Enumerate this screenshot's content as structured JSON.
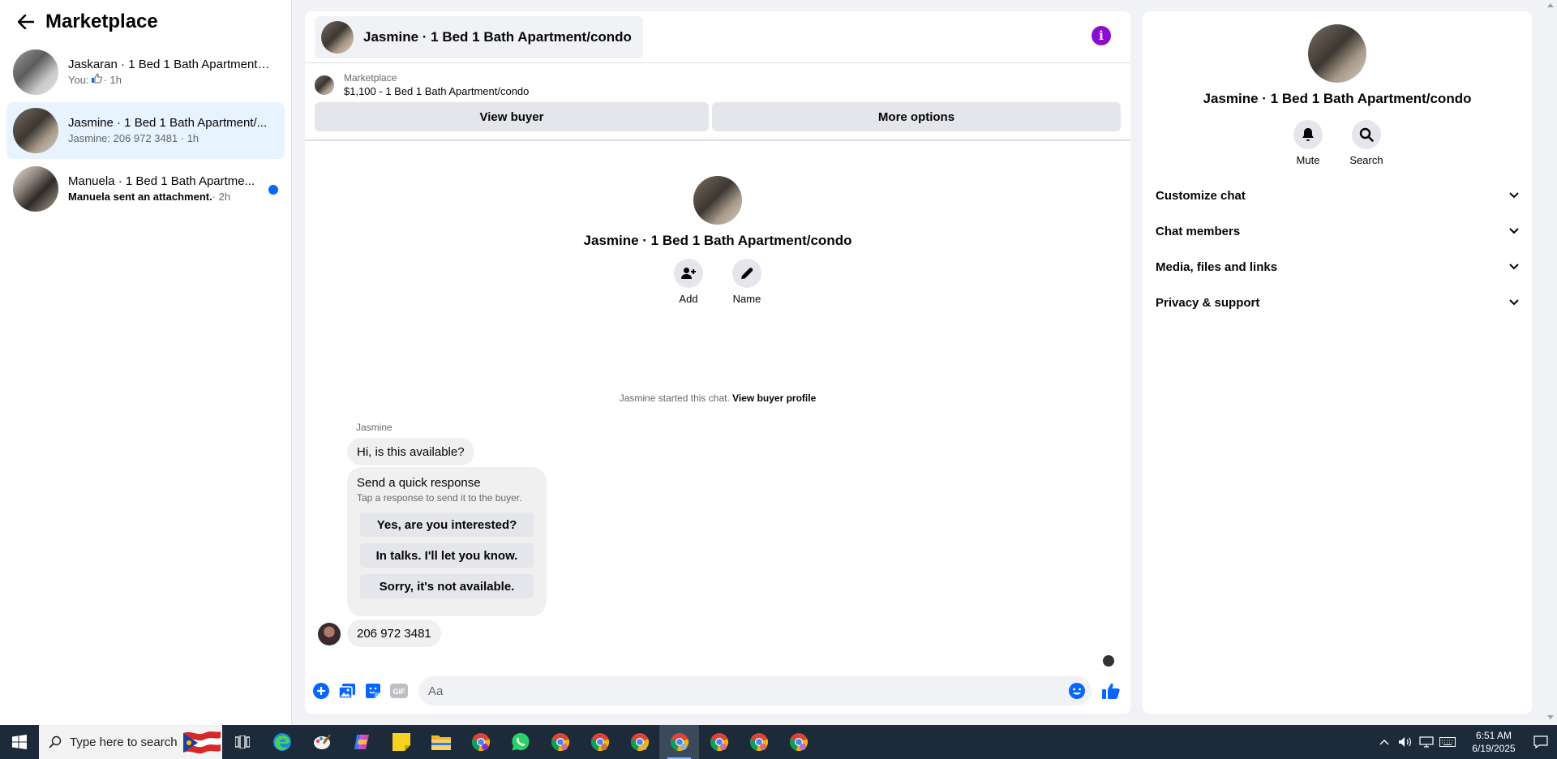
{
  "sidebar": {
    "title": "Marketplace",
    "conversations": [
      {
        "title": "Jaskaran · 1 Bed 1 Bath Apartment/...",
        "prefix": "You:",
        "time": "· 1h",
        "unread": false
      },
      {
        "title": "Jasmine · 1 Bed 1 Bath Apartment/...",
        "preview": "Jasmine: 206 972 3481 · 1h",
        "unread": false
      },
      {
        "title": "Manuela · 1 Bed 1 Bath Apartme...",
        "preview": "Manuela sent an attachment.",
        "time": " · 2h",
        "unread": true
      }
    ]
  },
  "chat": {
    "header_title": "Jasmine · 1 Bed 1 Bath Apartment/condo",
    "listing_label": "Marketplace",
    "listing_price": "$1,100 - 1 Bed 1 Bath Apartment/condo",
    "view_buyer": "View buyer",
    "more_options": "More options",
    "intro_title": "Jasmine · 1 Bed 1 Bath Apartment/condo",
    "add_label": "Add",
    "name_label": "Name",
    "started_text": "Jasmine started this chat.",
    "view_profile": "View buyer profile",
    "sender_name": "Jasmine",
    "message1": "Hi, is this available?",
    "quick_title": "Send a quick response",
    "quick_sub": "Tap a response to send it to the buyer.",
    "quick_responses": [
      "Yes, are you interested?",
      "In talks. I'll let you know.",
      "Sorry, it's not available."
    ],
    "message2": "206 972 3481",
    "composer_placeholder": "Aa"
  },
  "info_panel": {
    "title": "Jasmine · 1 Bed 1 Bath Apartment/condo",
    "mute": "Mute",
    "search": "Search",
    "sections": [
      "Customize chat",
      "Chat members",
      "Media, files and links",
      "Privacy & support"
    ]
  },
  "taskbar": {
    "search_placeholder": "Type here to search",
    "time": "6:51 AM",
    "date": "6/19/2025"
  },
  "colors": {
    "accent": "#0866ff",
    "active_conv": "#e7f3ff",
    "info_icon": "#8a0ecf"
  }
}
